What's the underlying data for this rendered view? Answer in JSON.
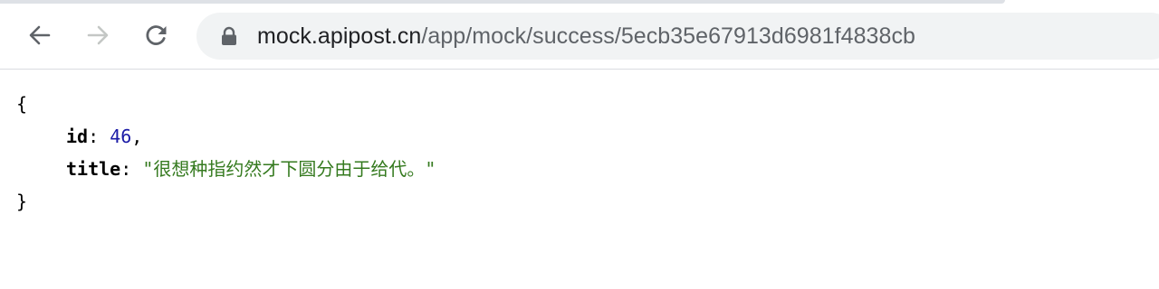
{
  "browser": {
    "url_host": "mock.apipost.cn",
    "url_path": "/app/mock/success/5ecb35e67913d6981f4838cb",
    "icons": {
      "back": "arrow-left-icon",
      "forward": "arrow-right-icon",
      "reload": "reload-icon",
      "security": "lock-icon"
    },
    "colors": {
      "toolbar_bg": "#ffffff",
      "omnibox_bg": "#f1f3f4",
      "icon_active": "#5f6368",
      "icon_disabled": "#c4c7c5"
    }
  },
  "json_view": {
    "open_brace": "{",
    "close_brace": "}",
    "fields": [
      {
        "key": "id",
        "colon": ":",
        "value": "46",
        "trailing": ","
      },
      {
        "key": "title",
        "colon": ":",
        "value": "\"很想种指约然才下圆分由于给代。\"",
        "trailing": ""
      }
    ],
    "colors": {
      "number": "#1a1aa6",
      "string": "#357a1f",
      "key": "#000000"
    }
  }
}
